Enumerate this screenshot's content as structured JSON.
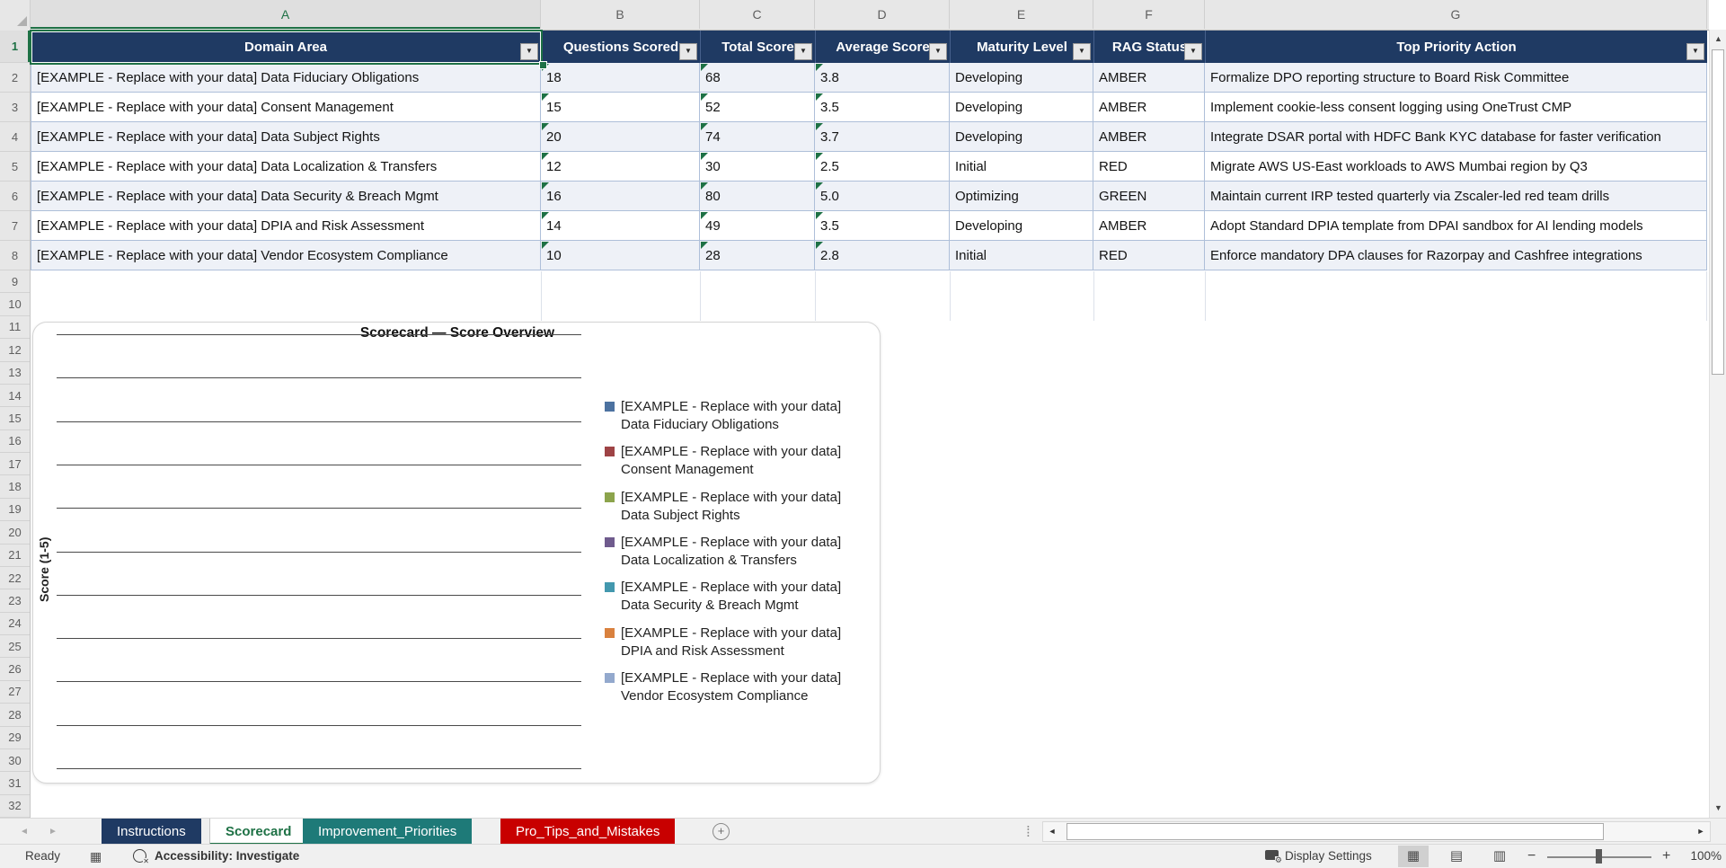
{
  "grid": {
    "column_letters": [
      "A",
      "B",
      "C",
      "D",
      "E",
      "F",
      "G"
    ],
    "row_numbers": [
      1,
      2,
      3,
      4,
      5,
      6,
      7,
      8,
      9,
      10,
      11,
      12,
      13,
      14,
      15,
      16,
      17,
      18,
      19,
      20,
      21,
      22,
      23,
      24,
      25,
      26,
      27,
      28,
      29,
      30,
      31,
      32
    ],
    "selected_cell": "A1",
    "selected_column": "A",
    "selected_row": 1
  },
  "table": {
    "headers": [
      "Domain Area",
      "Questions Scored",
      "Total Score",
      "Average Score",
      "Maturity Level",
      "RAG Status",
      "Top Priority Action"
    ],
    "header_fill": "#1F3A63",
    "band_fill": "#EEF1F7",
    "border_color": "#AEBFD9",
    "error_indicator_color": "#1E7145",
    "rows": [
      {
        "domain": "[EXAMPLE - Replace with your data] Data Fiduciary Obligations",
        "questions": "18",
        "total": "68",
        "average": "3.8",
        "maturity": "Developing",
        "rag": "AMBER",
        "action": "Formalize DPO reporting structure to Board Risk Committee"
      },
      {
        "domain": "[EXAMPLE - Replace with your data] Consent Management",
        "questions": "15",
        "total": "52",
        "average": "3.5",
        "maturity": "Developing",
        "rag": "AMBER",
        "action": "Implement cookie-less consent logging using OneTrust CMP"
      },
      {
        "domain": "[EXAMPLE - Replace with your data] Data Subject Rights",
        "questions": "20",
        "total": "74",
        "average": "3.7",
        "maturity": "Developing",
        "rag": "AMBER",
        "action": "Integrate DSAR portal with HDFC Bank KYC database for faster verification"
      },
      {
        "domain": "[EXAMPLE - Replace with your data] Data Localization & Transfers",
        "questions": "12",
        "total": "30",
        "average": "2.5",
        "maturity": "Initial",
        "rag": "RED",
        "action": "Migrate AWS US-East workloads to AWS Mumbai region by Q3"
      },
      {
        "domain": "[EXAMPLE - Replace with your data] Data Security & Breach Mgmt",
        "questions": "16",
        "total": "80",
        "average": "5.0",
        "maturity": "Optimizing",
        "rag": "GREEN",
        "action": "Maintain current IRP tested quarterly via Zscaler-led red team drills"
      },
      {
        "domain": "[EXAMPLE - Replace with your data] DPIA and Risk Assessment",
        "questions": "14",
        "total": "49",
        "average": "3.5",
        "maturity": "Developing",
        "rag": "AMBER",
        "action": "Adopt Standard DPIA template from DPAI sandbox for AI lending models"
      },
      {
        "domain": "[EXAMPLE - Replace with your data] Vendor Ecosystem Compliance",
        "questions": "10",
        "total": "28",
        "average": "2.8",
        "maturity": "Initial",
        "rag": "RED",
        "action": "Enforce mandatory DPA clauses for Razorpay and Cashfree integrations"
      }
    ]
  },
  "chart_data": {
    "type": "bar",
    "title": "Scorecard — Score Overview",
    "xlabel": "",
    "ylabel": "Score (1-5)",
    "ylim": [
      0,
      5
    ],
    "gridline_count": 11,
    "grid": "on",
    "legend_position": "right",
    "series_values_visible": false,
    "legend": [
      {
        "label": "[EXAMPLE - Replace with your data] Data Fiduciary Obligations",
        "color": "#4C72A0"
      },
      {
        "label": "[EXAMPLE - Replace with your data] Consent Management",
        "color": "#9E4345"
      },
      {
        "label": "[EXAMPLE - Replace with your data] Data Subject Rights",
        "color": "#8CA44C"
      },
      {
        "label": "[EXAMPLE - Replace with your data] Data Localization & Transfers",
        "color": "#6F5B8D"
      },
      {
        "label": "[EXAMPLE - Replace with your data] Data Security & Breach Mgmt",
        "color": "#4398AE"
      },
      {
        "label": "[EXAMPLE - Replace with your data] DPIA and Risk Assessment",
        "color": "#D9813E"
      },
      {
        "label": "[EXAMPLE - Replace with your data] Vendor Ecosystem Compliance",
        "color": "#93A9CD"
      }
    ]
  },
  "sheet_tabs": {
    "tabs": [
      {
        "label": "Instructions",
        "color": "#1F3A63",
        "active": false
      },
      {
        "label": "Scorecard",
        "color": "#FFFFFF",
        "active": true
      },
      {
        "label": "Improvement_Priorities",
        "color": "#1E7A78",
        "active": false
      },
      {
        "label": "Pro_Tips_and_Mistakes",
        "color": "#C80000",
        "active": false
      }
    ],
    "new_sheet_label": "+"
  },
  "status_bar": {
    "mode": "Ready",
    "accessibility": "Accessibility: Investigate",
    "display_settings": "Display Settings",
    "zoom_percent": "100%",
    "zoom_minus": "−",
    "zoom_plus": "+"
  },
  "icons": {
    "filter_arrow": "▼",
    "scroll_up": "▲",
    "scroll_down": "▼",
    "scroll_left": "◄",
    "scroll_right": "►",
    "tab_nav_left": "◄",
    "tab_nav_right": "►",
    "drag_dots": "⁞",
    "macro": "▦",
    "close_x": "✕",
    "gear": "⚙",
    "view_normal": "▦",
    "view_layout": "▤",
    "view_break": "▥"
  }
}
